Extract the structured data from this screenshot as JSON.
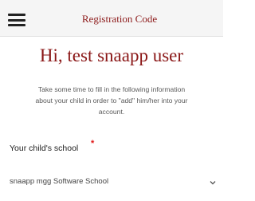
{
  "header": {
    "menu_icon": "hamburger-menu-icon",
    "title": "Registration Code"
  },
  "main": {
    "greeting": "Hi, test snaapp user",
    "instructions": [
      "Take some time to fill in the following information",
      "about your child in order to \"add\" him/her into your",
      "account."
    ],
    "school_field": {
      "label": "Your child's school",
      "required_marker": "*",
      "selected_value": "snaapp mgg Software School",
      "dropdown_icon": "chevron-down-icon"
    }
  },
  "colors": {
    "accent": "#8a1616",
    "required": "#e01414",
    "topbar_background": "#f5f5f5"
  }
}
